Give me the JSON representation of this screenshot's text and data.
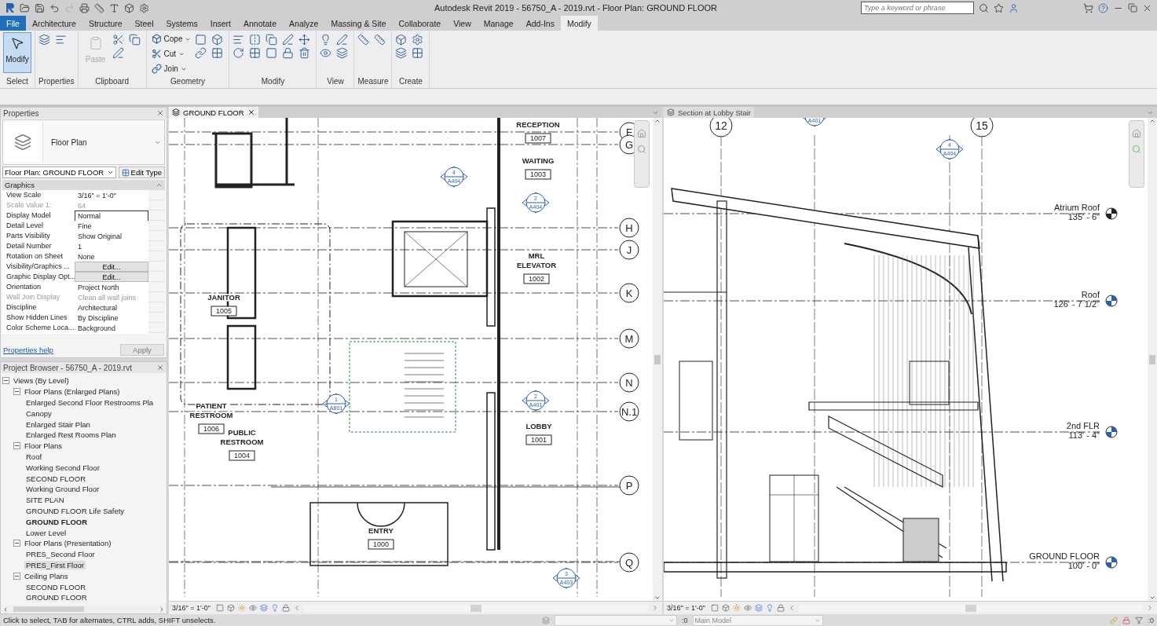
{
  "title_bar": {
    "title": "Autodesk Revit 2019 - 56750_A - 2019.rvt - Floor Plan: GROUND FLOOR",
    "search": {
      "placeholder": "Type a keyword or phrase"
    }
  },
  "ribbon_tabs": [
    {
      "label": "File",
      "kind": "file",
      "selected": false
    },
    {
      "label": "Architecture",
      "kind": "tab",
      "selected": false
    },
    {
      "label": "Structure",
      "kind": "tab",
      "selected": false
    },
    {
      "label": "Steel",
      "kind": "tab",
      "selected": false
    },
    {
      "label": "Systems",
      "kind": "tab",
      "selected": false
    },
    {
      "label": "Insert",
      "kind": "tab",
      "selected": false
    },
    {
      "label": "Annotate",
      "kind": "tab",
      "selected": false
    },
    {
      "label": "Analyze",
      "kind": "tab",
      "selected": false
    },
    {
      "label": "Massing & Site",
      "kind": "tab",
      "selected": false
    },
    {
      "label": "Collaborate",
      "kind": "tab",
      "selected": false
    },
    {
      "label": "View",
      "kind": "tab",
      "selected": false
    },
    {
      "label": "Manage",
      "kind": "tab",
      "selected": false
    },
    {
      "label": "Add-Ins",
      "kind": "tab",
      "selected": false
    },
    {
      "label": "Modify",
      "kind": "tab",
      "selected": true
    }
  ],
  "ribbon_panels": [
    {
      "label": "Select",
      "tools": [
        {
          "label": "Modify",
          "kind": "large",
          "selected": true,
          "disabled": false
        }
      ]
    },
    {
      "label": "Properties"
    },
    {
      "label": "Clipboard",
      "tools": [
        {
          "label": "Paste",
          "kind": "large",
          "selected": false,
          "disabled": true
        }
      ]
    },
    {
      "label": "Geometry",
      "tools": [
        {
          "label": "Cope",
          "kind": "small",
          "selected": false,
          "disabled": false
        },
        {
          "label": "Cut",
          "kind": "small",
          "selected": false,
          "disabled": false
        },
        {
          "label": "Join",
          "kind": "small",
          "selected": false,
          "disabled": false
        }
      ]
    },
    {
      "label": "Modify"
    },
    {
      "label": "View"
    },
    {
      "label": "Measure"
    },
    {
      "label": "Create"
    }
  ],
  "properties": {
    "title": "Properties",
    "type_name": "Floor Plan",
    "instance": "Floor Plan: GROUND FLOOR",
    "edit_type": "Edit Type",
    "group": "Graphics",
    "rows": [
      {
        "name": "View Scale",
        "value": "3/16\" = 1'-0\"",
        "kind": "text",
        "disabled": false
      },
      {
        "name": "Scale Value    1:",
        "value": "64",
        "kind": "text",
        "disabled": true
      },
      {
        "name": "Display Model",
        "value": "Normal",
        "kind": "field",
        "disabled": false
      },
      {
        "name": "Detail Level",
        "value": "Fine",
        "kind": "text",
        "disabled": false
      },
      {
        "name": "Parts Visibility",
        "value": "Show Original",
        "kind": "text",
        "disabled": false
      },
      {
        "name": "Detail Number",
        "value": "1",
        "kind": "text",
        "disabled": false
      },
      {
        "name": "Rotation on Sheet",
        "value": "None",
        "kind": "text",
        "disabled": false
      },
      {
        "name": "Visibility/Graphics ...",
        "value": "Edit...",
        "kind": "button",
        "disabled": false
      },
      {
        "name": "Graphic Display Opt...",
        "value": "Edit...",
        "kind": "button",
        "disabled": false
      },
      {
        "name": "Orientation",
        "value": "Project North",
        "kind": "text",
        "disabled": false
      },
      {
        "name": "Wall Join Display",
        "value": "Clean all wall joins",
        "kind": "text",
        "disabled": true
      },
      {
        "name": "Discipline",
        "value": "Architectural",
        "kind": "text",
        "disabled": false
      },
      {
        "name": "Show Hidden Lines",
        "value": "By Discipline",
        "kind": "text",
        "disabled": false
      },
      {
        "name": "Color Scheme Loca...",
        "value": "Background",
        "kind": "text",
        "disabled": false
      }
    ],
    "help": "Properties help",
    "apply": {
      "label": "Apply",
      "disabled": true
    }
  },
  "project_browser": {
    "title": "Project Browser - 56750_A - 2019.rvt",
    "tree": [
      {
        "label": "Views (By Level)",
        "expanded": true,
        "selected": false,
        "active": false,
        "children": [
          {
            "label": "Floor Plans (Enlarged Plans)",
            "expanded": true,
            "selected": false,
            "active": false,
            "children": [
              {
                "label": "Enlarged Second Floor Restrooms Pla",
                "selected": false,
                "active": false
              },
              {
                "label": "Canopy",
                "selected": false,
                "active": false
              },
              {
                "label": "Enlarged Stair Plan",
                "selected": false,
                "active": false
              },
              {
                "label": "Enlarged Rest Rooms Plan",
                "selected": false,
                "active": false
              }
            ]
          },
          {
            "label": "Floor Plans",
            "expanded": true,
            "selected": false,
            "active": false,
            "children": [
              {
                "label": "Roof",
                "selected": false,
                "active": false
              },
              {
                "label": "Working Second Floor",
                "selected": false,
                "active": false
              },
              {
                "label": "SECOND FLOOR",
                "selected": false,
                "active": false
              },
              {
                "label": "Working Ground Floor",
                "selected": false,
                "active": false
              },
              {
                "label": "SITE PLAN",
                "selected": false,
                "active": false
              },
              {
                "label": "GROUND FLOOR Life Safety",
                "selected": false,
                "active": false
              },
              {
                "label": "GROUND FLOOR",
                "selected": false,
                "active": true
              },
              {
                "label": "Lower Level",
                "selected": false,
                "active": false
              }
            ]
          },
          {
            "label": "Floor Plans (Presentation)",
            "expanded": true,
            "selected": false,
            "active": false,
            "children": [
              {
                "label": "PRES_Second Floor",
                "selected": false,
                "active": false
              },
              {
                "label": "PRES_First Floor",
                "selected": true,
                "active": false
              }
            ]
          },
          {
            "label": "Ceiling Plans",
            "expanded": true,
            "selected": false,
            "active": false,
            "children": [
              {
                "label": "SECOND FLOOR",
                "selected": false,
                "active": false
              },
              {
                "label": "GROUND FLOOR",
                "selected": false,
                "active": false
              }
            ]
          }
        ]
      }
    ]
  },
  "plan_view": {
    "tab": "GROUND FLOOR",
    "scale": "3/16\" = 1'-0\"",
    "rooms": [
      {
        "name": [
          "RECEPTION"
        ],
        "number": "1007"
      },
      {
        "name": [
          "WAITING"
        ],
        "number": "1003"
      },
      {
        "name": [
          "MRL",
          "ELEVATOR"
        ],
        "number": "1002"
      },
      {
        "name": [
          "LOBBY"
        ],
        "number": "1001"
      },
      {
        "name": [
          "JANITOR"
        ],
        "number": "1005"
      },
      {
        "name": [
          "PATIENT",
          "RESTROOM"
        ],
        "number": "1006"
      },
      {
        "name": [
          "PUBLIC",
          "RESTROOM"
        ],
        "number": "1004"
      },
      {
        "name": [
          "ENTRY"
        ],
        "number": "1000"
      }
    ],
    "grids": [
      "F",
      "G",
      "H",
      "J",
      "K",
      "M",
      "N",
      "N.1",
      "P",
      "Q"
    ],
    "markers": [
      {
        "number": "4",
        "sheet": "A404"
      },
      {
        "number": "2",
        "sheet": "A404"
      },
      {
        "number": "1",
        "sheet": "A801"
      },
      {
        "number": "2",
        "sheet": "A401"
      },
      {
        "number": "3",
        "sheet": "A403"
      }
    ]
  },
  "section_view": {
    "tab": "Section at Lobby Stair",
    "scale": "3/16\" = 1'-0\"",
    "grids": [
      "12",
      "15"
    ],
    "markers": [
      {
        "sheet": "A401"
      },
      {
        "number": "4",
        "sheet": "A404"
      }
    ],
    "levels": [
      {
        "name": "Atrium Roof",
        "elevation": "135' - 6\""
      },
      {
        "name": "Roof",
        "elevation": "126' - 7 1/2\""
      },
      {
        "name": "2nd FLR",
        "elevation": "113' - 4\""
      },
      {
        "name": "GROUND FLOOR",
        "elevation": "100' - 0\""
      }
    ]
  },
  "status_bar": {
    "message": "Click to select, TAB for alternates, CTRL adds, SHIFT unselects.",
    "workset_count": ":0",
    "design_option": "Main Model",
    "filter_count": ":0"
  }
}
